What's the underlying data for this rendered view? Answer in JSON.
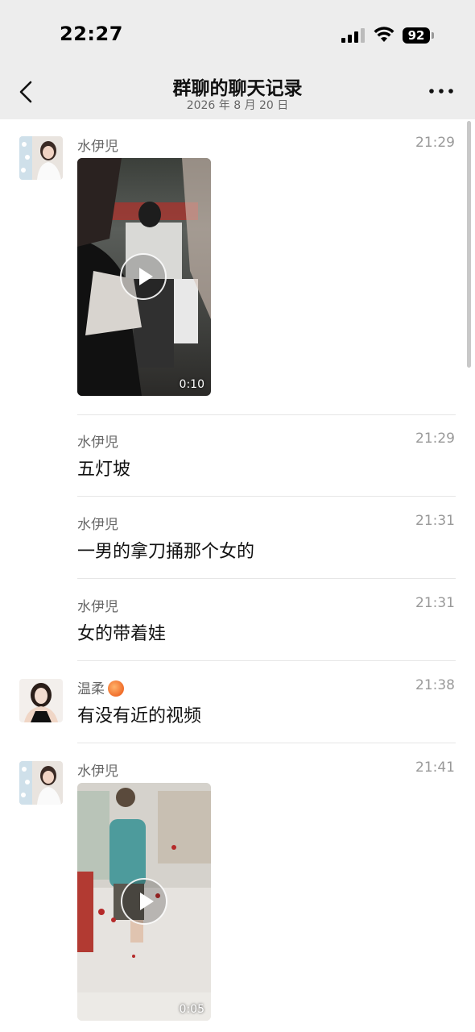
{
  "status": {
    "time": "22:27",
    "battery": "92"
  },
  "header": {
    "title": "群聊的聊天记录",
    "subtitle": "2026 年 8 月 20 日"
  },
  "messages": [
    {
      "sender": "水伊児",
      "time": "21:29",
      "type": "video",
      "duration": "0:10"
    },
    {
      "sender": "水伊児",
      "time": "21:29",
      "type": "text",
      "text": "五灯坡"
    },
    {
      "sender": "水伊児",
      "time": "21:31",
      "type": "text",
      "text": "一男的拿刀捅那个女的"
    },
    {
      "sender": "水伊児",
      "time": "21:31",
      "type": "text",
      "text": "女的带着娃"
    },
    {
      "sender": "温柔",
      "sender_emoji": "peach-icon",
      "time": "21:38",
      "type": "text",
      "text": "有没有近的视频"
    },
    {
      "sender": "水伊児",
      "time": "21:41",
      "type": "video",
      "duration": "0:05"
    }
  ],
  "colors": {
    "header_bg": "#ededed",
    "divider": "#e6e6e6",
    "time_text": "#999999"
  }
}
